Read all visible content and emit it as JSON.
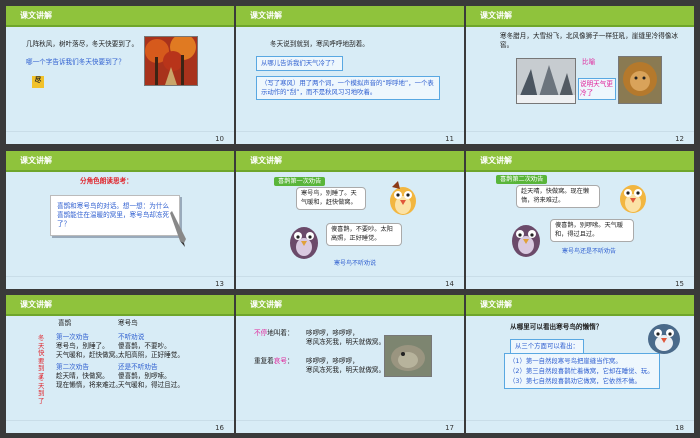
{
  "header_label": "课文讲解",
  "slides": {
    "s10": {
      "num": "10",
      "line1": "几阵秋风，树叶落尽，冬天快要到了。",
      "line2": "哪一个字告诉我们冬天快要到了？",
      "answer": "尽"
    },
    "s11": {
      "num": "11",
      "line1": "冬天说到就到，寒风呼呼地刮着。",
      "question": "从哪儿告诉我们天气冷了？",
      "note": "（写了寒风）用了两个词，一个模拟声音的“呼呼地”，一个表示动作的“刮”，而不是秋风习习地吹着。"
    },
    "s12": {
      "num": "12",
      "text": "寒冬腊月，大雪纷飞，北风像狮子一样狂吼，崖缝里冷得像冰窖。",
      "label_compare": "比喻",
      "label_reason": "说明天气更冷了"
    },
    "s13": {
      "num": "13",
      "heading": "分角色朗读思考：",
      "card_text": "喜鹊和寒号鸟的对话。想一想：为什么喜鹊能住在温暖的窝里，寒号鸟却冻死了？"
    },
    "s14": {
      "num": "14",
      "tag1": "喜鹊第一次劝告",
      "bubble1": "寒号鸟，别睡了。天气暖和，赶快做窝。",
      "bubble2": "傻喜鹊，不要吵。太阳高照，正好睡觉。",
      "tag2": "寒号鸟不听劝说"
    },
    "s15": {
      "num": "15",
      "tag1": "喜鹊第二次劝告",
      "bubble1": "趁天晴，快做窝。现在懒惰，将来难过。",
      "bubble2": "傻喜鹊，别啰嗦。天气暖和，得过且过。",
      "tag2": "寒号鸟还是不听劝告"
    },
    "s16": {
      "num": "16",
      "col1": "喜鹊",
      "col2": "寒号鸟",
      "side1": "冬天快要到了",
      "side2": "冬天到了",
      "a1": "第一次劝告",
      "a2": "寒号鸟，别睡了。",
      "a3": "天气暖和，赶快做窝。",
      "a4": "第二次劝告",
      "a5": "趁天晴，快做窝。",
      "a6": "现在懒惰，将来难过。",
      "b1": "不听劝说",
      "b2": "傻喜鹊，不要吵。",
      "b3": "太阳高照，正好睡觉。",
      "b4": "还是不听劝告",
      "b5": "傻喜鹊，别啰嗦。",
      "b6": "天气暖和，得过且过。"
    },
    "s17": {
      "num": "17",
      "k1a": "不停",
      "k1b": "地叫着：",
      "line1a": "哆啰啰，哆啰啰，",
      "line1b": "寒风冻死我，明天就做窝。",
      "k2a": "重复着",
      "k2b": "哀号",
      "k2c": "：",
      "line2a": "哆啰啰，哆啰啰，",
      "line2b": "寒风冻死我，明天就做窝。"
    },
    "s18": {
      "num": "18",
      "question": "从哪里可以看出寒号鸟的懒惰？",
      "aspect": "从三个方面可以看出：",
      "p1": "（1）第一自然段寒号鸟把崖缝当作窝。",
      "p2": "（2）第三自然段喜鹊忙着做窝，它却在睡觉、玩。",
      "p3": "（3）第七自然段喜鹊劝它做窝，它依然不做。"
    }
  }
}
